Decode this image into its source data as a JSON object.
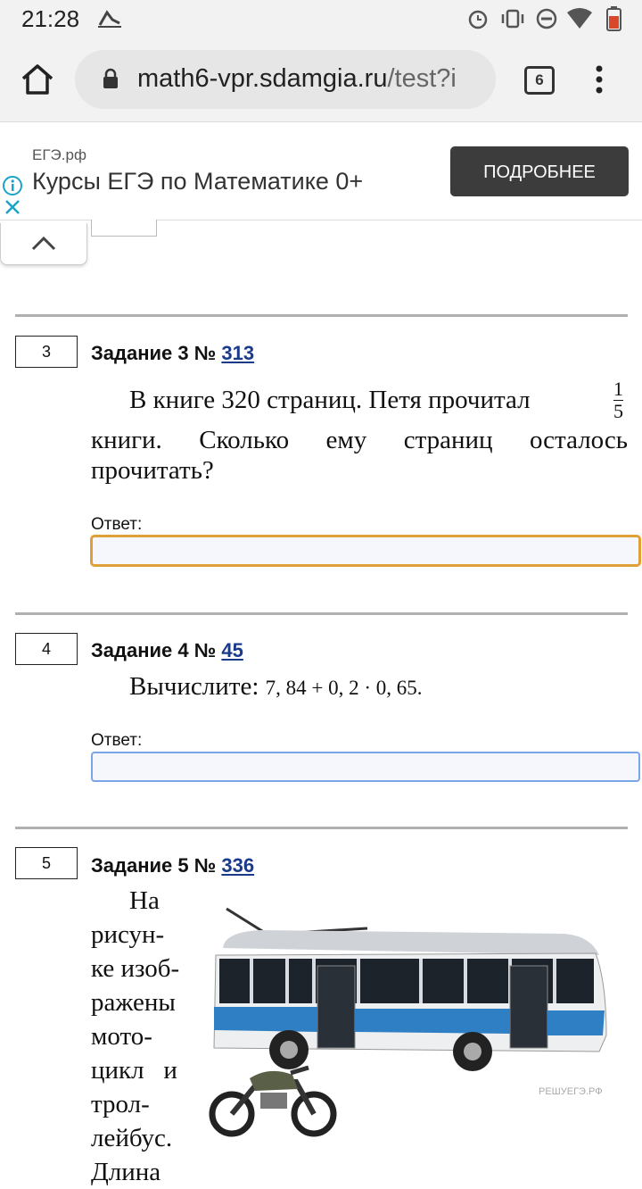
{
  "status_bar": {
    "time": "21:28"
  },
  "browser": {
    "url_host": "math6-vpr.sdamgia.ru",
    "url_path": "/test?i",
    "tab_count": "6"
  },
  "ad": {
    "site": "ЕГЭ.рф",
    "title": "Курсы ЕГЭ по Математике 0+",
    "button_label": "ПОДРОБНЕЕ"
  },
  "tasks": [
    {
      "number": "3",
      "header": "Задание 3 №",
      "link": "313",
      "text_line1": "В книге 320 страниц. Петя прочитал",
      "fraction_num": "1",
      "fraction_den": "5",
      "text_line2": "книги. Сколько ему страниц осталось",
      "text_line3": "прочитать?",
      "answer_label": "Ответ:",
      "answer_value": ""
    },
    {
      "number": "4",
      "header": "Задание 4 №",
      "link": "45",
      "text": "Вычислите:",
      "expression": "7, 84 + 0, 2 · 0, 65.",
      "answer_label": "Ответ:",
      "answer_value": ""
    },
    {
      "number": "5",
      "header": "Задание 5 №",
      "link": "336",
      "text_lines": [
        "На",
        "рисун-",
        "ке изоб-",
        "ражены",
        "мото-",
        "цикл   и",
        "трол-",
        "лейбус.",
        "Длина"
      ],
      "image_watermark": "РЕШУЕГЭ.РФ"
    }
  ],
  "colors": {
    "answer_border": "#7aa6e6",
    "focused_border": "#e0a038",
    "link": "#1a3a8a"
  }
}
